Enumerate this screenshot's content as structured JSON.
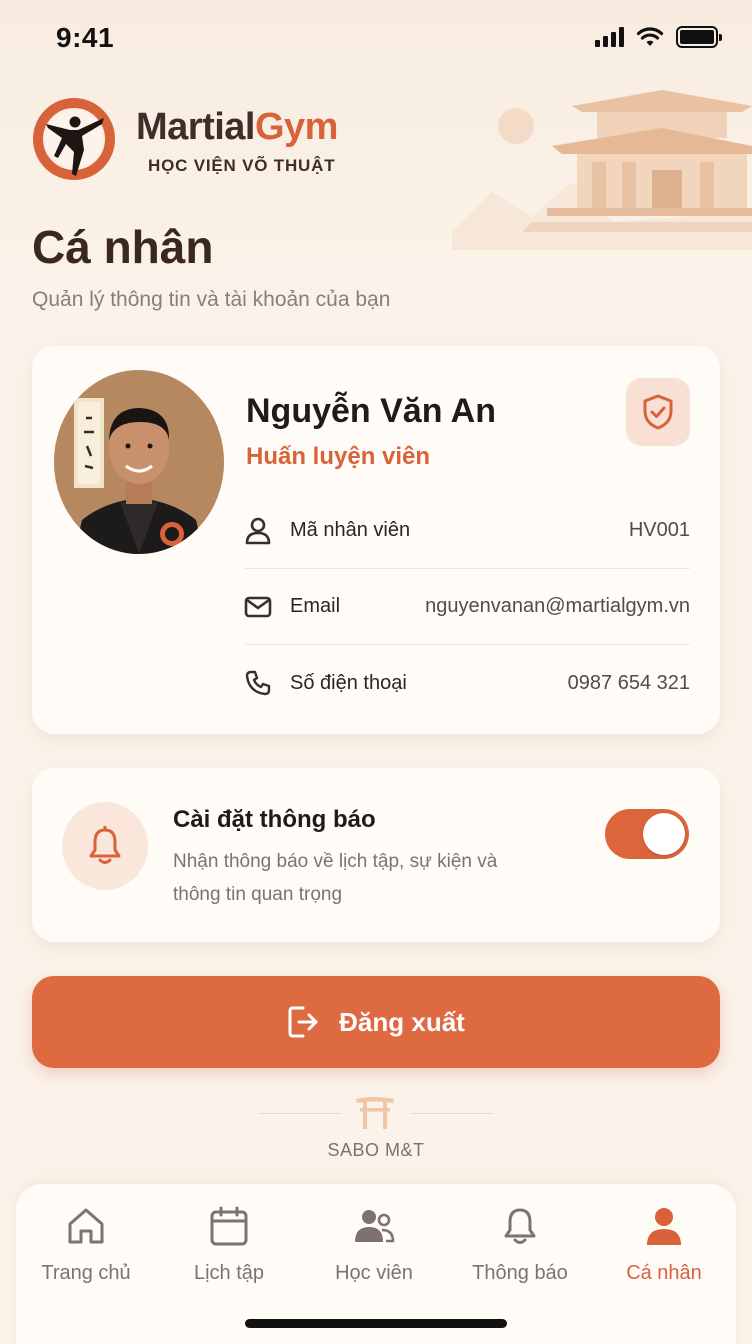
{
  "status_bar": {
    "time": "9:41"
  },
  "brand": {
    "name_part1": "Martial",
    "name_part2": "Gym",
    "subtitle": "HỌC VIỆN VÕ THUẬT"
  },
  "page": {
    "title": "Cá nhân",
    "subtitle": "Quản lý thông tin và tài khoản của bạn"
  },
  "profile": {
    "name": "Nguyễn Văn An",
    "role": "Huấn luyện viên",
    "rows": [
      {
        "icon": "user-icon",
        "label": "Mã nhân viên",
        "value": "HV001"
      },
      {
        "icon": "mail-icon",
        "label": "Email",
        "value": "nguyenvanan@martialgym.vn"
      },
      {
        "icon": "phone-icon",
        "label": "Số điện thoại",
        "value": "0987 654 321"
      }
    ]
  },
  "notifications": {
    "title": "Cài đặt thông báo",
    "description": "Nhận thông báo về lịch tập, sự kiện và thông tin quan trọng",
    "enabled": true
  },
  "logout": {
    "label": "Đăng xuất"
  },
  "footer": {
    "text": "SABO M&T"
  },
  "nav": {
    "items": [
      {
        "label": "Trang chủ",
        "icon": "home-icon",
        "active": false
      },
      {
        "label": "Lịch tập",
        "icon": "calendar-icon",
        "active": false
      },
      {
        "label": "Học viên",
        "icon": "students-icon",
        "active": false
      },
      {
        "label": "Thông báo",
        "icon": "bell-icon",
        "active": false
      },
      {
        "label": "Cá nhân",
        "icon": "user-icon",
        "active": true
      }
    ]
  },
  "colors": {
    "accent": "#d8623a",
    "background": "#fbf3ea",
    "card": "#fffbf7"
  }
}
